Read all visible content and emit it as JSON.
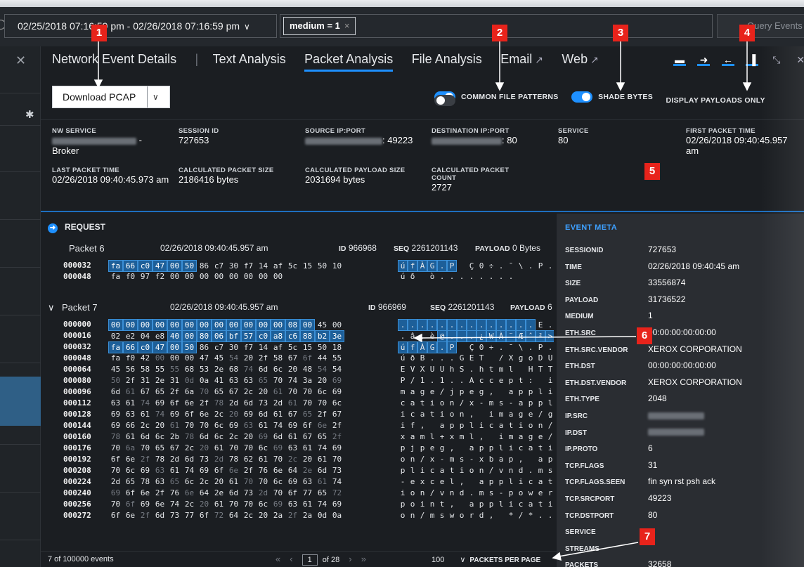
{
  "topbar": {
    "time_range": "02/25/2018 07:16:59 pm - 02/26/2018 07:16:59 pm",
    "query_pill": "medium = 1",
    "query_button": "Query Events"
  },
  "tabs": [
    {
      "label": "Network Event Details"
    },
    {
      "label": "|"
    },
    {
      "label": "Text Analysis"
    },
    {
      "label": "Packet Analysis"
    },
    {
      "label": "File Analysis"
    },
    {
      "label": "Email"
    },
    {
      "label": "Web"
    }
  ],
  "download": {
    "label": "Download PCAP"
  },
  "toggles": [
    {
      "label": "COMMON FILE PATTERNS",
      "on": true
    },
    {
      "label": "SHADE BYTES",
      "on": true
    },
    {
      "label": "DISPLAY PAYLOADS ONLY",
      "on": false
    }
  ],
  "summary": {
    "nw_service_label": "NW SERVICE",
    "nw_service_value": "Broker",
    "session_id_label": "SESSION ID",
    "session_id_value": "727653",
    "source_label": "SOURCE IP:PORT",
    "source_value": ": 49223",
    "dest_label": "DESTINATION IP:PORT",
    "dest_value": ": 80",
    "service_label": "SERVICE",
    "service_value": "80",
    "first_label": "FIRST PACKET TIME",
    "first_value": "02/26/2018 09:40:45.957 am",
    "last_label": "LAST PACKET TIME",
    "last_value": "02/26/2018 09:40:45.973 am",
    "calc_size_label": "CALCULATED PACKET SIZE",
    "calc_size_value": "2186416 bytes",
    "calc_payload_label": "CALCULATED PAYLOAD SIZE",
    "calc_payload_value": "2031694 bytes",
    "calc_count_label": "CALCULATED PACKET COUNT",
    "calc_count_value": "2727"
  },
  "request": {
    "label": "REQUEST"
  },
  "packet6": {
    "name": "Packet 6",
    "time": "02/26/2018 09:40:45.957 am",
    "id_label": "ID",
    "id": "966968",
    "seq_label": "SEQ",
    "seq": "2261201143",
    "payload_label": "PAYLOAD",
    "payload": "0 Bytes"
  },
  "packet7": {
    "name": "Packet 7",
    "time": "02/26/2018 09:40:45.957 am",
    "id_label": "ID",
    "id": "966969",
    "seq_label": "SEQ",
    "seq": "2261201143",
    "payload_label": "PAYLOAD",
    "payload": "6"
  },
  "hex6": [
    {
      "off": "000032",
      "bytes": [
        "fa",
        "66",
        "c0",
        "47",
        "00",
        "50",
        "86",
        "c7",
        "30",
        "f7",
        "14",
        "af",
        "5c",
        "15",
        "50",
        "10"
      ],
      "ascii": [
        "ú",
        "f",
        "À",
        "G",
        ".",
        "P",
        "",
        "Ç",
        "0",
        "÷",
        ".",
        "¯",
        "\\",
        ".",
        "P",
        "."
      ]
    },
    {
      "off": "000048",
      "bytes": [
        "fa",
        "f0",
        "97",
        "f2",
        "00",
        "00",
        "00",
        "00",
        "00",
        "00",
        "00",
        "00",
        "",
        "",
        "",
        ""
      ],
      "ascii": [
        "ú",
        "ð",
        "",
        "ò",
        ".",
        ".",
        ".",
        ".",
        ".",
        ".",
        ".",
        ".",
        "",
        "",
        "",
        ""
      ]
    }
  ],
  "hex7": [
    {
      "off": "000000",
      "bytes": [
        "00",
        "00",
        "00",
        "00",
        "00",
        "00",
        "00",
        "00",
        "00",
        "00",
        "00",
        "00",
        "08",
        "00",
        "45",
        "00"
      ],
      "ascii": [
        ".",
        ".",
        ".",
        ".",
        ".",
        ".",
        ".",
        ".",
        ".",
        ".",
        ".",
        ".",
        ".",
        ".",
        "E",
        "."
      ]
    },
    {
      "off": "000016",
      "bytes": [
        "02",
        "e2",
        "04",
        "e8",
        "40",
        "00",
        "80",
        "06",
        "bf",
        "57",
        "c0",
        "a8",
        "c6",
        "88",
        "b2",
        "3e"
      ],
      "ascii": [
        ".",
        "â",
        ".",
        "è",
        "@",
        ".",
        ".",
        ".",
        "¿",
        "W",
        "À",
        "¨",
        "Æ",
        "ˆ",
        "²",
        ">"
      ]
    },
    {
      "off": "000032",
      "bytes": [
        "fa",
        "66",
        "c0",
        "47",
        "00",
        "50",
        "86",
        "c7",
        "30",
        "f7",
        "14",
        "af",
        "5c",
        "15",
        "50",
        "18"
      ],
      "ascii": [
        "ú",
        "f",
        "À",
        "G",
        ".",
        "P",
        "",
        "Ç",
        "0",
        "÷",
        ".",
        "¯",
        "\\",
        ".",
        "P",
        "."
      ]
    },
    {
      "off": "000048",
      "bytes": [
        "fa",
        "f0",
        "42",
        "00",
        "00",
        "00",
        "47",
        "45",
        "54",
        "20",
        "2f",
        "58",
        "67",
        "6f",
        "44",
        "55"
      ],
      "ascii": [
        "ú",
        "ð",
        "B",
        ".",
        ".",
        ".",
        "G",
        "E",
        "T",
        " ",
        "/",
        "X",
        "g",
        "o",
        "D",
        "U"
      ]
    },
    {
      "off": "000064",
      "bytes": [
        "45",
        "56",
        "58",
        "55",
        "55",
        "68",
        "53",
        "2e",
        "68",
        "74",
        "6d",
        "6c",
        "20",
        "48",
        "54",
        "54"
      ],
      "ascii": [
        "E",
        "V",
        "X",
        "U",
        "U",
        "h",
        "S",
        ".",
        "h",
        "t",
        "m",
        "l",
        " ",
        "H",
        "T",
        "T"
      ]
    },
    {
      "off": "000080",
      "bytes": [
        "50",
        "2f",
        "31",
        "2e",
        "31",
        "0d",
        "0a",
        "41",
        "63",
        "63",
        "65",
        "70",
        "74",
        "3a",
        "20",
        "69"
      ],
      "ascii": [
        "P",
        "/",
        "1",
        ".",
        "1",
        ".",
        ".",
        "A",
        "c",
        "c",
        "e",
        "p",
        "t",
        ":",
        " ",
        "i"
      ]
    },
    {
      "off": "000096",
      "bytes": [
        "6d",
        "61",
        "67",
        "65",
        "2f",
        "6a",
        "70",
        "65",
        "67",
        "2c",
        "20",
        "61",
        "70",
        "70",
        "6c",
        "69"
      ],
      "ascii": [
        "m",
        "a",
        "g",
        "e",
        "/",
        "j",
        "p",
        "e",
        "g",
        ",",
        " ",
        "a",
        "p",
        "p",
        "l",
        "i"
      ]
    },
    {
      "off": "000112",
      "bytes": [
        "63",
        "61",
        "74",
        "69",
        "6f",
        "6e",
        "2f",
        "78",
        "2d",
        "6d",
        "73",
        "2d",
        "61",
        "70",
        "70",
        "6c"
      ],
      "ascii": [
        "c",
        "a",
        "t",
        "i",
        "o",
        "n",
        "/",
        "x",
        "-",
        "m",
        "s",
        "-",
        "a",
        "p",
        "p",
        "l"
      ]
    },
    {
      "off": "000128",
      "bytes": [
        "69",
        "63",
        "61",
        "74",
        "69",
        "6f",
        "6e",
        "2c",
        "20",
        "69",
        "6d",
        "61",
        "67",
        "65",
        "2f",
        "67"
      ],
      "ascii": [
        "i",
        "c",
        "a",
        "t",
        "i",
        "o",
        "n",
        ",",
        " ",
        "i",
        "m",
        "a",
        "g",
        "e",
        "/",
        "g"
      ]
    },
    {
      "off": "000144",
      "bytes": [
        "69",
        "66",
        "2c",
        "20",
        "61",
        "70",
        "70",
        "6c",
        "69",
        "63",
        "61",
        "74",
        "69",
        "6f",
        "6e",
        "2f"
      ],
      "ascii": [
        "i",
        "f",
        ",",
        " ",
        "a",
        "p",
        "p",
        "l",
        "i",
        "c",
        "a",
        "t",
        "i",
        "o",
        "n",
        "/"
      ]
    },
    {
      "off": "000160",
      "bytes": [
        "78",
        "61",
        "6d",
        "6c",
        "2b",
        "78",
        "6d",
        "6c",
        "2c",
        "20",
        "69",
        "6d",
        "61",
        "67",
        "65",
        "2f"
      ],
      "ascii": [
        "x",
        "a",
        "m",
        "l",
        "+",
        "x",
        "m",
        "l",
        ",",
        " ",
        "i",
        "m",
        "a",
        "g",
        "e",
        "/"
      ]
    },
    {
      "off": "000176",
      "bytes": [
        "70",
        "6a",
        "70",
        "65",
        "67",
        "2c",
        "20",
        "61",
        "70",
        "70",
        "6c",
        "69",
        "63",
        "61",
        "74",
        "69"
      ],
      "ascii": [
        "p",
        "j",
        "p",
        "e",
        "g",
        ",",
        " ",
        "a",
        "p",
        "p",
        "l",
        "i",
        "c",
        "a",
        "t",
        "i"
      ]
    },
    {
      "off": "000192",
      "bytes": [
        "6f",
        "6e",
        "2f",
        "78",
        "2d",
        "6d",
        "73",
        "2d",
        "78",
        "62",
        "61",
        "70",
        "2c",
        "20",
        "61",
        "70"
      ],
      "ascii": [
        "o",
        "n",
        "/",
        "x",
        "-",
        "m",
        "s",
        "-",
        "x",
        "b",
        "a",
        "p",
        ",",
        " ",
        "a",
        "p"
      ]
    },
    {
      "off": "000208",
      "bytes": [
        "70",
        "6c",
        "69",
        "63",
        "61",
        "74",
        "69",
        "6f",
        "6e",
        "2f",
        "76",
        "6e",
        "64",
        "2e",
        "6d",
        "73"
      ],
      "ascii": [
        "p",
        "l",
        "i",
        "c",
        "a",
        "t",
        "i",
        "o",
        "n",
        "/",
        "v",
        "n",
        "d",
        ".",
        "m",
        "s"
      ]
    },
    {
      "off": "000224",
      "bytes": [
        "2d",
        "65",
        "78",
        "63",
        "65",
        "6c",
        "2c",
        "20",
        "61",
        "70",
        "70",
        "6c",
        "69",
        "63",
        "61",
        "74"
      ],
      "ascii": [
        "-",
        "e",
        "x",
        "c",
        "e",
        "l",
        ",",
        " ",
        "a",
        "p",
        "p",
        "l",
        "i",
        "c",
        "a",
        "t"
      ]
    },
    {
      "off": "000240",
      "bytes": [
        "69",
        "6f",
        "6e",
        "2f",
        "76",
        "6e",
        "64",
        "2e",
        "6d",
        "73",
        "2d",
        "70",
        "6f",
        "77",
        "65",
        "72"
      ],
      "ascii": [
        "i",
        "o",
        "n",
        "/",
        "v",
        "n",
        "d",
        ".",
        "m",
        "s",
        "-",
        "p",
        "o",
        "w",
        "e",
        "r"
      ]
    },
    {
      "off": "000256",
      "bytes": [
        "70",
        "6f",
        "69",
        "6e",
        "74",
        "2c",
        "20",
        "61",
        "70",
        "70",
        "6c",
        "69",
        "63",
        "61",
        "74",
        "69"
      ],
      "ascii": [
        "p",
        "o",
        "i",
        "n",
        "t",
        ",",
        " ",
        "a",
        "p",
        "p",
        "l",
        "i",
        "c",
        "a",
        "t",
        "i"
      ]
    },
    {
      "off": "000272",
      "bytes": [
        "6f",
        "6e",
        "2f",
        "6d",
        "73",
        "77",
        "6f",
        "72",
        "64",
        "2c",
        "20",
        "2a",
        "2f",
        "2a",
        "0d",
        "0a"
      ],
      "ascii": [
        "o",
        "n",
        "/",
        "m",
        "s",
        "w",
        "o",
        "r",
        "d",
        ",",
        " ",
        "*",
        "/",
        "*",
        ".",
        "."
      ]
    }
  ],
  "meta": {
    "title": "EVENT META",
    "rows": [
      {
        "k": "SESSIONID",
        "v": "727653"
      },
      {
        "k": "TIME",
        "v": "02/26/2018 09:40:45 am"
      },
      {
        "k": "SIZE",
        "v": "33556874"
      },
      {
        "k": "PAYLOAD",
        "v": "31736522"
      },
      {
        "k": "MEDIUM",
        "v": "1"
      },
      {
        "k": "ETH.SRC",
        "v": "00:00:00:00:00:00"
      },
      {
        "k": "ETH.SRC.VENDOR",
        "v": "XEROX CORPORATION"
      },
      {
        "k": "ETH.DST",
        "v": "00:00:00:00:00:00"
      },
      {
        "k": "ETH.DST.VENDOR",
        "v": "XEROX CORPORATION"
      },
      {
        "k": "ETH.TYPE",
        "v": "2048"
      },
      {
        "k": "IP.SRC",
        "v": ""
      },
      {
        "k": "IP.DST",
        "v": ""
      },
      {
        "k": "IP.PROTO",
        "v": "6"
      },
      {
        "k": "TCP.FLAGS",
        "v": "31"
      },
      {
        "k": "TCP.FLAGS.SEEN",
        "v": "fin syn rst psh ack"
      },
      {
        "k": "TCP.SRCPORT",
        "v": "49223"
      },
      {
        "k": "TCP.DSTPORT",
        "v": "80"
      },
      {
        "k": "SERVICE",
        "v": ""
      },
      {
        "k": "STREAMS",
        "v": ""
      },
      {
        "k": "PACKETS",
        "v": "32658"
      }
    ]
  },
  "footer": {
    "count": "7 of 100000 events",
    "page": "1",
    "of_pages": "of 28",
    "per_page": "100",
    "per_page_label": "PACKETS PER PAGE"
  },
  "callouts": [
    "1",
    "2",
    "3",
    "4",
    "5",
    "6",
    "7"
  ],
  "colors": {
    "accent": "#1e90ff",
    "callout": "#e8231b",
    "highlight": "#1d5f99"
  }
}
